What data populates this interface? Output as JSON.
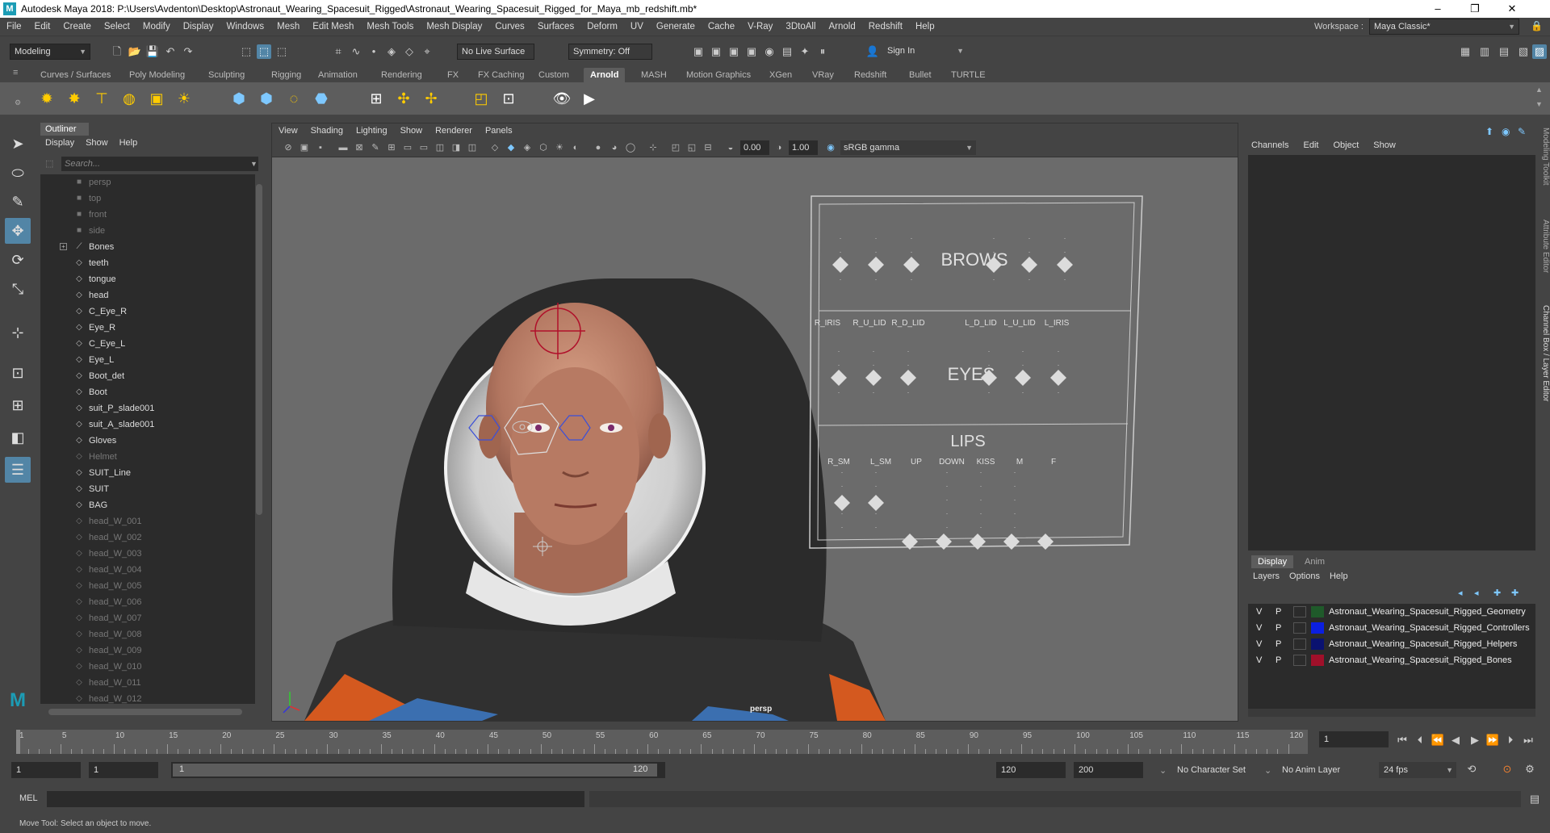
{
  "window": {
    "title": "Autodesk Maya 2018: P:\\Users\\Avdenton\\Desktop\\Astronaut_Wearing_Spacesuit_Rigged\\Astronaut_Wearing_Spacesuit_Rigged_for_Maya_mb_redshift.mb*",
    "app_icon": "M",
    "minimize": "–",
    "maximize": "❐",
    "close": "✕"
  },
  "menubar": [
    "File",
    "Edit",
    "Create",
    "Select",
    "Modify",
    "Display",
    "Windows",
    "Mesh",
    "Edit Mesh",
    "Mesh Tools",
    "Mesh Display",
    "Curves",
    "Surfaces",
    "Deform",
    "UV",
    "Generate",
    "Cache",
    "V-Ray",
    "3DtoAll",
    "Arnold",
    "Redshift",
    "Help"
  ],
  "workspace": {
    "label": "Workspace :",
    "value": "Maya Classic*"
  },
  "status": {
    "mode": "Modeling",
    "live_surface": "No Live Surface",
    "symmetry": "Symmetry: Off",
    "sign_in": "Sign In"
  },
  "shelf_tabs": [
    "Curves / Surfaces",
    "Poly Modeling",
    "Sculpting",
    "Rigging",
    "Animation",
    "Rendering",
    "FX",
    "FX Caching",
    "Custom",
    "Arnold",
    "MASH",
    "Motion Graphics",
    "XGen",
    "VRay",
    "Redshift",
    "Bullet",
    "TURTLE"
  ],
  "shelf_active": "Arnold",
  "outliner": {
    "title": "Outliner",
    "menu": [
      "Display",
      "Show",
      "Help"
    ],
    "search_placeholder": "Search...",
    "items": [
      {
        "label": "persp",
        "dim": true,
        "icon": "camera-icon"
      },
      {
        "label": "top",
        "dim": true,
        "icon": "camera-icon"
      },
      {
        "label": "front",
        "dim": true,
        "icon": "camera-icon"
      },
      {
        "label": "side",
        "dim": true,
        "icon": "camera-icon"
      },
      {
        "label": "Bones",
        "dim": false,
        "icon": "joint-icon",
        "expandable": true
      },
      {
        "label": "teeth",
        "dim": false,
        "icon": "mesh-icon"
      },
      {
        "label": "tongue",
        "dim": false,
        "icon": "mesh-icon"
      },
      {
        "label": "head",
        "dim": false,
        "icon": "mesh-icon"
      },
      {
        "label": "C_Eye_R",
        "dim": false,
        "icon": "mesh-icon"
      },
      {
        "label": "Eye_R",
        "dim": false,
        "icon": "mesh-icon"
      },
      {
        "label": "C_Eye_L",
        "dim": false,
        "icon": "mesh-icon"
      },
      {
        "label": "Eye_L",
        "dim": false,
        "icon": "mesh-icon"
      },
      {
        "label": "Boot_det",
        "dim": false,
        "icon": "mesh-icon"
      },
      {
        "label": "Boot",
        "dim": false,
        "icon": "mesh-icon"
      },
      {
        "label": "suit_P_slade001",
        "dim": false,
        "icon": "mesh-icon"
      },
      {
        "label": "suit_A_slade001",
        "dim": false,
        "icon": "mesh-icon"
      },
      {
        "label": "Gloves",
        "dim": false,
        "icon": "mesh-icon"
      },
      {
        "label": "Helmet",
        "dim": true,
        "icon": "mesh-icon"
      },
      {
        "label": "SUIT_Line",
        "dim": false,
        "icon": "mesh-icon"
      },
      {
        "label": "SUIT",
        "dim": false,
        "icon": "mesh-icon"
      },
      {
        "label": "BAG",
        "dim": false,
        "icon": "mesh-icon"
      },
      {
        "label": "head_W_001",
        "dim": true,
        "icon": "mesh-icon"
      },
      {
        "label": "head_W_002",
        "dim": true,
        "icon": "mesh-icon"
      },
      {
        "label": "head_W_003",
        "dim": true,
        "icon": "mesh-icon"
      },
      {
        "label": "head_W_004",
        "dim": true,
        "icon": "mesh-icon"
      },
      {
        "label": "head_W_005",
        "dim": true,
        "icon": "mesh-icon"
      },
      {
        "label": "head_W_006",
        "dim": true,
        "icon": "mesh-icon"
      },
      {
        "label": "head_W_007",
        "dim": true,
        "icon": "mesh-icon"
      },
      {
        "label": "head_W_008",
        "dim": true,
        "icon": "mesh-icon"
      },
      {
        "label": "head_W_009",
        "dim": true,
        "icon": "mesh-icon"
      },
      {
        "label": "head_W_010",
        "dim": true,
        "icon": "mesh-icon"
      },
      {
        "label": "head_W_011",
        "dim": true,
        "icon": "mesh-icon"
      },
      {
        "label": "head_W_012",
        "dim": true,
        "icon": "mesh-icon"
      }
    ]
  },
  "viewport": {
    "menu": [
      "View",
      "Shading",
      "Lighting",
      "Show",
      "Renderer",
      "Panels"
    ],
    "exposure": "0.00",
    "gamma": "1.00",
    "color_space": "sRGB gamma",
    "camera_label": "persp",
    "facial_ui": {
      "brows": "BROWS",
      "eyes": "EYES",
      "lips": "LIPS",
      "eye_labels": [
        "R_IRIS",
        "R_U_LID",
        "R_D_LID",
        "L_D_LID",
        "L_U_LID",
        "L_IRIS"
      ],
      "lip_labels": [
        "R_SM",
        "L_SM",
        "UP",
        "DOWN",
        "KISS",
        "M",
        "F"
      ]
    }
  },
  "channel_box": {
    "menu": [
      "Channels",
      "Edit",
      "Object",
      "Show"
    ]
  },
  "layer_editor": {
    "tabs": [
      "Display",
      "Anim"
    ],
    "menu": [
      "Layers",
      "Options",
      "Help"
    ],
    "layers": [
      {
        "v": "V",
        "p": "P",
        "color": "#1f5a2a",
        "name": "Astronaut_Wearing_Spacesuit_Rigged_Geometry"
      },
      {
        "v": "V",
        "p": "P",
        "color": "#0b1fe0",
        "name": "Astronaut_Wearing_Spacesuit_Rigged_Controllers"
      },
      {
        "v": "V",
        "p": "P",
        "color": "#0a1270",
        "name": "Astronaut_Wearing_Spacesuit_Rigged_Helpers"
      },
      {
        "v": "V",
        "p": "P",
        "color": "#a0102a",
        "name": "Astronaut_Wearing_Spacesuit_Rigged_Bones"
      }
    ]
  },
  "side_tabs": [
    "Modeling Toolkit",
    "Attribute Editor",
    "Channel Box / Layer Editor"
  ],
  "timeline": {
    "ticks": [
      "1",
      "5",
      "10",
      "15",
      "20",
      "25",
      "30",
      "35",
      "40",
      "45",
      "50",
      "55",
      "60",
      "65",
      "70",
      "75",
      "80",
      "85",
      "90",
      "95",
      "100",
      "105",
      "110",
      "115",
      "120"
    ],
    "current_frame": "1"
  },
  "range": {
    "start": "1",
    "playback_start": "1",
    "slider_start": "1",
    "slider_end": "120",
    "playback_end": "120",
    "end": "200",
    "character_set": "No Character Set",
    "anim_layer": "No Anim Layer",
    "fps": "24 fps"
  },
  "command": {
    "label": "MEL"
  },
  "help_line": "Move Tool: Select an object to move."
}
